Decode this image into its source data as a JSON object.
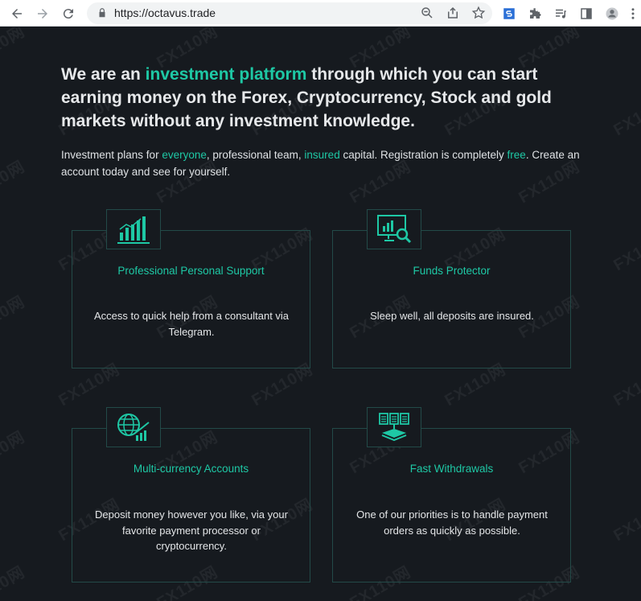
{
  "browser": {
    "url": "https://octavus.trade",
    "icons": [
      "back-icon",
      "forward-icon",
      "reload-icon",
      "lock-icon",
      "zoom-icon",
      "share-icon",
      "bookmark-star-icon",
      "extension-s-icon",
      "extensions-puzzle-icon",
      "media-icon",
      "side-panel-icon",
      "profile-icon",
      "menu-icon"
    ]
  },
  "hero": {
    "pre": "We are an ",
    "highlight": "investment platform",
    "post": " through which you can start earning money on the Forex, Cryptocurrency, Stock and gold markets without any investment knowledge."
  },
  "intro": {
    "p1": "Investment plans for ",
    "h1": "everyone",
    "p2": ", professional team, ",
    "h2": "insured",
    "p3": " capital. Registration is completely ",
    "h3": "free",
    "p4": ". Create an account today and see for yourself."
  },
  "features": [
    {
      "icon": "bar-chart-icon",
      "title": "Professional Personal Support",
      "text": "Access to quick help from a consultant via Telegram."
    },
    {
      "icon": "monitor-search-icon",
      "title": "Funds Protector",
      "text": "Sleep well, all deposits are insured."
    },
    {
      "icon": "globe-chart-icon",
      "title": "Multi-currency Accounts",
      "text": "Deposit money however you like, via your favorite payment processor or cryptocurrency."
    },
    {
      "icon": "documents-stack-icon",
      "title": "Fast Withdrawals",
      "text": "One of our priorities is to handle payment orders as quickly as possible."
    }
  ],
  "watermark": "FX110网",
  "colors": {
    "accent": "#1ec8a5",
    "background": "#161a1f",
    "border": "#234a48"
  }
}
